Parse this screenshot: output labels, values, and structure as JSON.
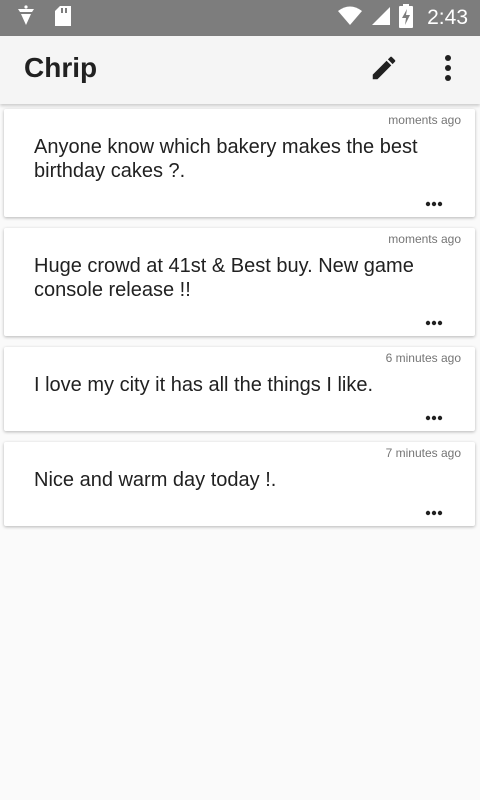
{
  "status_bar": {
    "time": "2:43",
    "icons": [
      "notification-icon",
      "sd-card-icon",
      "wifi-icon",
      "signal-icon",
      "battery-charging-icon"
    ]
  },
  "app_bar": {
    "title": "Chrip",
    "compose_icon": "pencil-icon",
    "overflow_icon": "more-vert-icon"
  },
  "posts": [
    {
      "time": "moments ago",
      "text": "Anyone know which bakery makes the best birthday cakes ?.",
      "more_icon": "more-horiz-icon"
    },
    {
      "time": "moments ago",
      "text": "Huge crowd at 41st & Best buy. New game console release !!",
      "more_icon": "more-horiz-icon"
    },
    {
      "time": "6 minutes ago",
      "text": "I love my city it has all the things I like.",
      "more_icon": "more-horiz-icon"
    },
    {
      "time": "7 minutes ago",
      "text": "Nice and warm day today !.",
      "more_icon": "more-horiz-icon"
    }
  ],
  "colors": {
    "status_bar": "#7d7d7d",
    "app_bar": "#f5f5f5",
    "background": "#fafafa",
    "card": "#ffffff",
    "text": "#212121",
    "muted": "#757575"
  }
}
